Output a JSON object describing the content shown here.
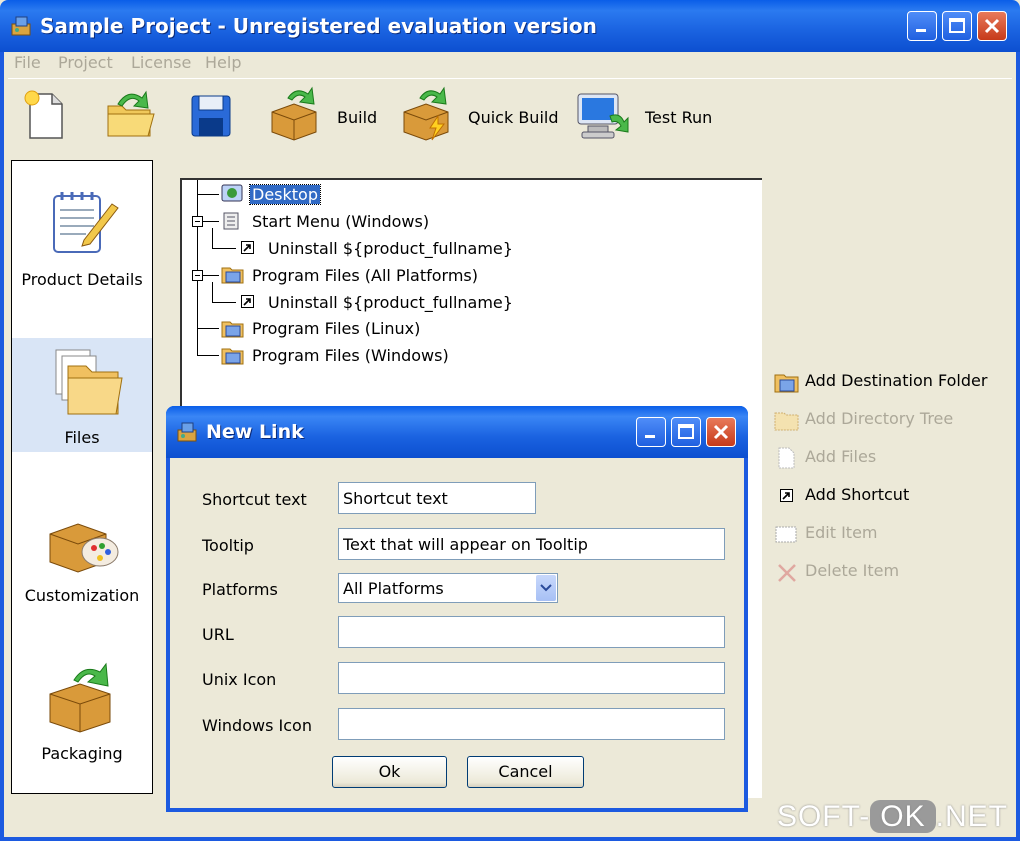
{
  "window": {
    "title": "Sample Project - Unregistered evaluation version"
  },
  "menu": [
    "File",
    "Project",
    "License",
    "Help"
  ],
  "toolbar": {
    "new_icon": "new-document-icon",
    "open_icon": "open-folder-icon",
    "save_icon": "floppy-disk-icon",
    "build_label": "Build",
    "quick_build_label": "Quick Build",
    "test_run_label": "Test Run"
  },
  "nav": [
    {
      "label": "Product Details",
      "icon": "notepad-pencil-icon"
    },
    {
      "label": "Files",
      "icon": "folder-files-icon",
      "selected": true
    },
    {
      "label": "Customization",
      "icon": "palette-box-icon"
    },
    {
      "label": "Packaging",
      "icon": "package-box-icon"
    }
  ],
  "tree": {
    "desktop": "Desktop",
    "start_menu": "Start Menu (Windows)",
    "uninstall_1": "Uninstall ${product_fullname}",
    "program_files_all": "Program Files (All Platforms)",
    "uninstall_2": "Uninstall ${product_fullname}",
    "program_files_linux": "Program Files (Linux)",
    "program_files_windows": "Program Files (Windows)"
  },
  "actions": {
    "add_destination_folder": "Add Destination Folder",
    "add_directory_tree": "Add Directory Tree",
    "add_files": "Add Files",
    "add_shortcut": "Add Shortcut",
    "edit_item": "Edit Item",
    "delete_item": "Delete Item"
  },
  "dialog": {
    "title": "New Link",
    "shortcut_text_label": "Shortcut text",
    "shortcut_text_value": "Shortcut text",
    "tooltip_label": "Tooltip",
    "tooltip_value": "Text that will appear on Tooltip",
    "platforms_label": "Platforms",
    "platforms_value": "All Platforms",
    "url_label": "URL",
    "url_value": "",
    "unix_icon_label": "Unix Icon",
    "unix_icon_value": "",
    "windows_icon_label": "Windows Icon",
    "windows_icon_value": "",
    "ok_label": "Ok",
    "cancel_label": "Cancel"
  },
  "watermark": {
    "prefix": "SOFT-",
    "ok": "OK",
    "suffix": ".NET"
  },
  "colors": {
    "titlebar": "#0a5ee8",
    "selection": "#316ac5",
    "nav_selected": "#d9e5f6",
    "disabled_text": "#aca899"
  }
}
